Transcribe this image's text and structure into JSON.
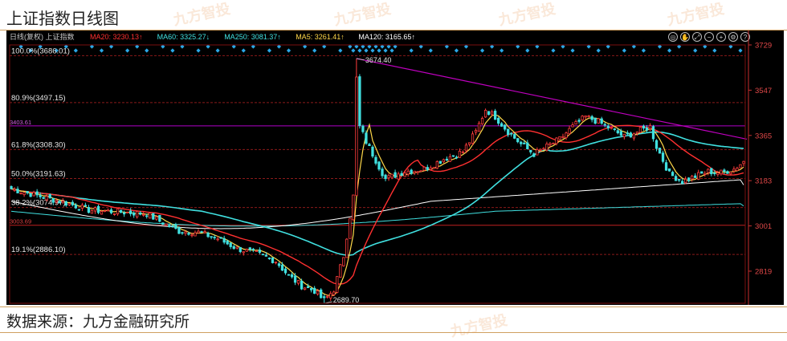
{
  "page": {
    "title": "上证指数日线图",
    "source": "数据来源：九方金融研究所",
    "watermark": "九方智投"
  },
  "indicator_bar": {
    "prefix": "日线(复权)  上证指数",
    "items": [
      {
        "text": "MA20: 3230.13↑",
        "color": "#ff3030"
      },
      {
        "text": "MA60: 3325.27↓",
        "color": "#40e0e0"
      },
      {
        "text": "MA250: 3081.37↑",
        "color": "#40e0e0"
      },
      {
        "text": "MA5: 3261.41↑",
        "color": "#ffd84a"
      },
      {
        "text": "MA120: 3165.65↑",
        "color": "#ffffff"
      }
    ],
    "toolbar_icons": [
      "eye-icon",
      "hand-icon",
      "expand-icon",
      "minus-icon",
      "plus-icon",
      "gear-icon",
      "help-icon"
    ]
  },
  "colors": {
    "up": "#ff3c3c",
    "down": "#40e0e0",
    "ma5": "#ffd84a",
    "ma20": "#ff3030",
    "ma60": "#40e0e0",
    "ma120": "#ffffff",
    "ma250": "#40e0e0",
    "trendline": "#c000c0",
    "fib_line": "#8a1a1a",
    "signal": "#2aa8e8",
    "price_axis": "#c83030"
  },
  "chart_data": {
    "type": "candlestick",
    "title": "上证指数日线图",
    "ylim": [
      2689.7,
      3729
    ],
    "y_ticks": [
      3729,
      3547,
      3365,
      3183,
      3001,
      2819
    ],
    "fib_levels": [
      {
        "label": "100.0%(3686.01)",
        "value": 3686.01
      },
      {
        "label": "80.9%(3497.15)",
        "value": 3497.15
      },
      {
        "label": "61.8%(3308.30)",
        "value": 3308.3
      },
      {
        "label": "50.0%(3191.63)",
        "value": 3191.63
      },
      {
        "label": "38.2%(3074.97)",
        "value": 3074.97
      },
      {
        "label": "19.1%(2886.10)",
        "value": 2886.1
      }
    ],
    "horizontal_lines": [
      {
        "label": "3403.61",
        "value": 3403.61
      },
      {
        "label": "3003.69",
        "value": 3003.69
      }
    ],
    "annotations": [
      {
        "text": "3674.40",
        "value": 3674.4
      },
      {
        "text": "2689.70",
        "value": 2689.7
      }
    ],
    "trendline": {
      "from": 3674.4,
      "to": 3350
    },
    "path_keypoints": [
      [
        0,
        3150
      ],
      [
        6,
        3130
      ],
      [
        12,
        3110
      ],
      [
        18,
        3090
      ],
      [
        24,
        3065
      ],
      [
        30,
        3060
      ],
      [
        36,
        3055
      ],
      [
        42,
        3050
      ],
      [
        46,
        3020
      ],
      [
        52,
        2980
      ],
      [
        58,
        2975
      ],
      [
        64,
        2950
      ],
      [
        70,
        2910
      ],
      [
        76,
        2890
      ],
      [
        82,
        2860
      ],
      [
        86,
        2800
      ],
      [
        90,
        2760
      ],
      [
        94,
        2740
      ],
      [
        97,
        2700
      ],
      [
        100,
        2745
      ],
      [
        103,
        2880
      ],
      [
        106,
        3120
      ],
      [
        107,
        3660
      ],
      [
        108,
        3400
      ],
      [
        110,
        3340
      ],
      [
        116,
        3190
      ],
      [
        122,
        3220
      ],
      [
        128,
        3230
      ],
      [
        134,
        3270
      ],
      [
        140,
        3300
      ],
      [
        144,
        3380
      ],
      [
        147,
        3470
      ],
      [
        150,
        3440
      ],
      [
        154,
        3380
      ],
      [
        158,
        3330
      ],
      [
        162,
        3290
      ],
      [
        166,
        3320
      ],
      [
        170,
        3350
      ],
      [
        174,
        3400
      ],
      [
        178,
        3440
      ],
      [
        182,
        3420
      ],
      [
        186,
        3390
      ],
      [
        190,
        3360
      ],
      [
        194,
        3380
      ],
      [
        198,
        3400
      ],
      [
        200,
        3320
      ],
      [
        204,
        3210
      ],
      [
        208,
        3180
      ],
      [
        212,
        3200
      ],
      [
        216,
        3220
      ],
      [
        220,
        3215
      ],
      [
        224,
        3230
      ],
      [
        227,
        3260
      ]
    ],
    "ma_ends": {
      "ma5": 3261.41,
      "ma20": 3230.13,
      "ma60": 3325.27,
      "ma120": 3165.65,
      "ma250": 3081.37
    }
  }
}
